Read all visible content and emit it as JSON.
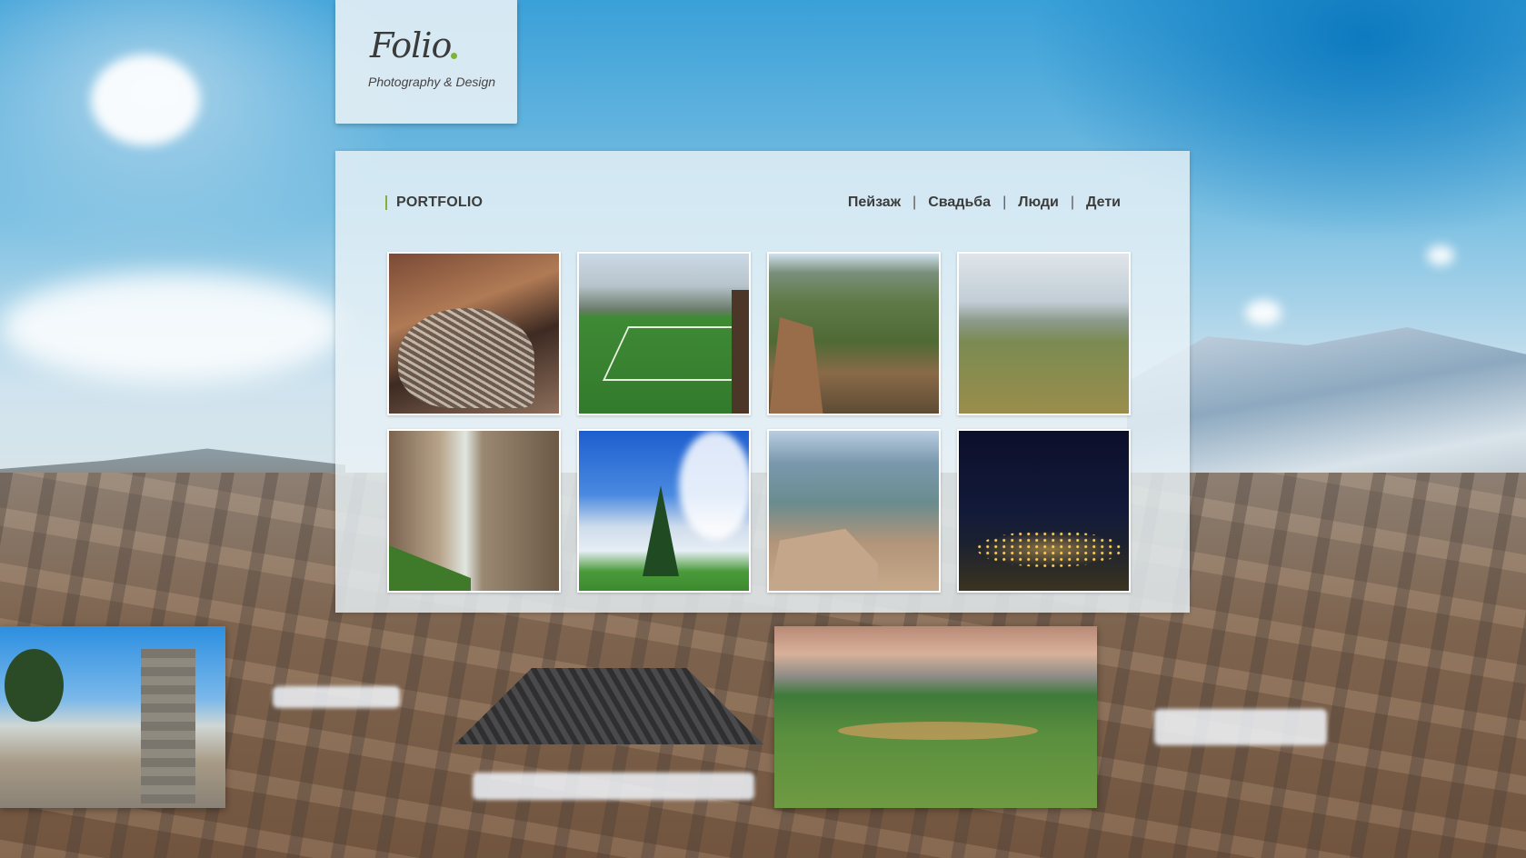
{
  "logo": {
    "name": "Folio",
    "tagline": "Photography & Design"
  },
  "portfolio": {
    "title": "PORTFOLIO",
    "filters": [
      {
        "label": "Пейзаж"
      },
      {
        "label": "Свадьба"
      },
      {
        "label": "Люди"
      },
      {
        "label": "Дети"
      }
    ],
    "separator": "|",
    "thumbnails": [
      {
        "subject": "mountain-village-aerial"
      },
      {
        "subject": "football-pitch"
      },
      {
        "subject": "canyon-valley"
      },
      {
        "subject": "highland-plain"
      },
      {
        "subject": "waterfall-gorge"
      },
      {
        "subject": "tree-monument"
      },
      {
        "subject": "cliff-viewpoint"
      },
      {
        "subject": "city-lights-night"
      }
    ]
  },
  "colors": {
    "accent": "#7fb23a",
    "text": "#3c3c3c"
  }
}
